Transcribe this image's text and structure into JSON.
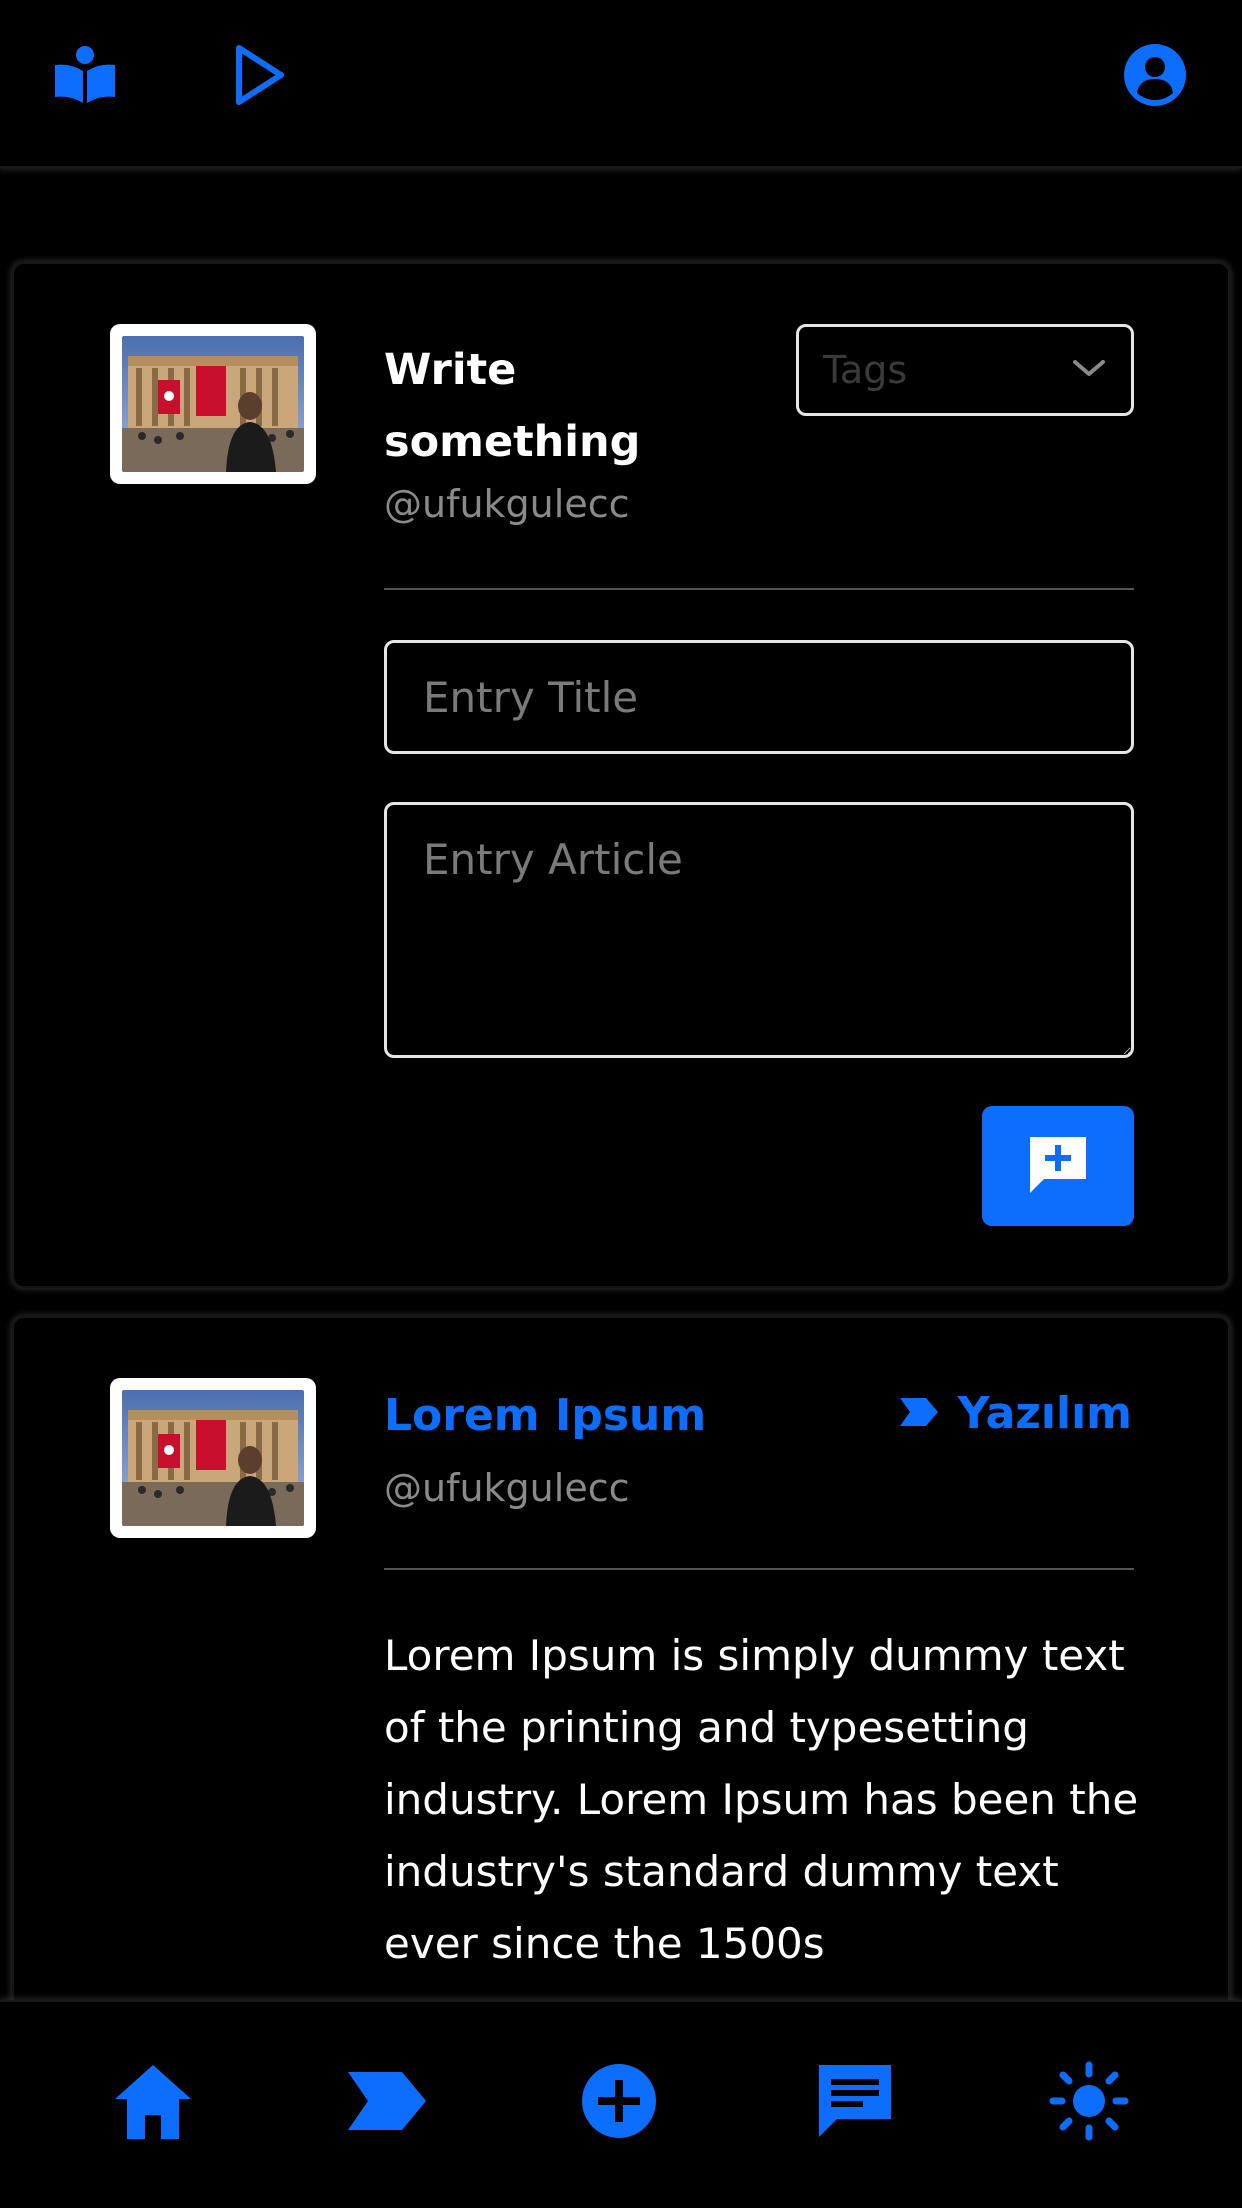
{
  "colors": {
    "accent": "#0d6efd",
    "background": "#000000",
    "muted_text": "#8a8a8a",
    "border": "#e6e6e6"
  },
  "header": {
    "icons": [
      "open-book-icon",
      "play-icon",
      "user-circle-icon"
    ]
  },
  "compose": {
    "title": "Write something",
    "handle": "@ufukgulecc",
    "tags_placeholder": "Tags",
    "entry_title_placeholder": "Entry Title",
    "entry_article_placeholder": "Entry Article",
    "submit_icon": "add-comment-icon"
  },
  "entries": [
    {
      "title": "Lorem Ipsum",
      "handle": "@ufukgulecc",
      "tag": "Yazılım",
      "tag_icon": "label-icon",
      "body": "Lorem Ipsum is simply dummy text of the printing and typesetting industry. Lorem Ipsum has been the industry's standard dummy text ever since the 1500s"
    }
  ],
  "bottom_nav": {
    "icons": [
      "home-icon",
      "label-icon",
      "add-circle-icon",
      "chat-icon",
      "sun-icon"
    ]
  }
}
